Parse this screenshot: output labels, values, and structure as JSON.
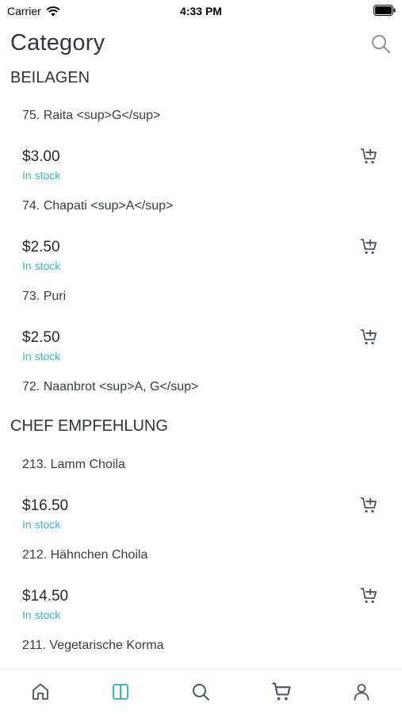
{
  "status": {
    "carrier": "Carrier",
    "time": "4:33 PM"
  },
  "header": {
    "title": "Category",
    "search_icon": "search-icon"
  },
  "sections": [
    {
      "title": "BEILAGEN",
      "items": [
        {
          "name": "75. Raita <sup>G</sup>",
          "price": "$3.00",
          "stock": "In stock"
        },
        {
          "name": "74. Chapati <sup>A</sup>",
          "price": "$2.50",
          "stock": "In stock"
        },
        {
          "name": "73. Puri",
          "price": "$2.50",
          "stock": "In stock"
        },
        {
          "name": "72. Naanbrot <sup>A, G</sup>"
        }
      ]
    },
    {
      "title": "CHEF EMPFEHLUNG",
      "items": [
        {
          "name": "213. Lamm Choila",
          "price": "$16.50",
          "stock": "In stock"
        },
        {
          "name": "212. Hähnchen Choila",
          "price": "$14.50",
          "stock": "In stock"
        },
        {
          "name": "211. Vegetarische Korma"
        }
      ]
    }
  ],
  "tabs": [
    {
      "icon": "home-icon",
      "active": false
    },
    {
      "icon": "category-icon",
      "active": true
    },
    {
      "icon": "search-icon",
      "active": false
    },
    {
      "icon": "cart-icon",
      "active": false
    },
    {
      "icon": "user-icon",
      "active": false
    }
  ],
  "colors": {
    "accent": "#3bb7c5",
    "text": "#2b3340",
    "icon": "#4a5563"
  }
}
